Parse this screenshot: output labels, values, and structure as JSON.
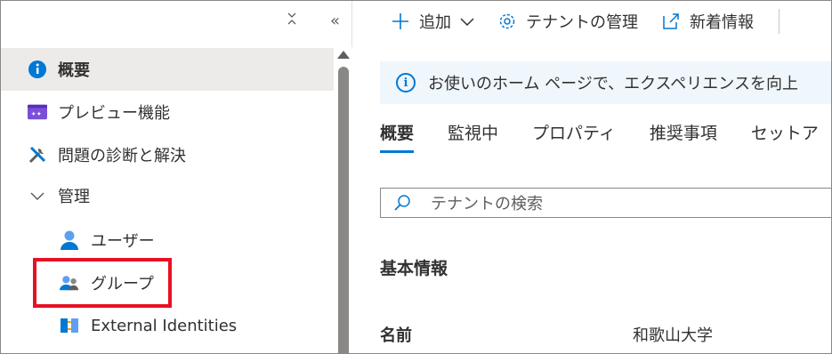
{
  "nav": {
    "controls": {
      "collapse": "⌅",
      "double_left": "«"
    },
    "items": [
      {
        "label": "概要",
        "icon": "info-icon",
        "selected": true
      },
      {
        "label": "プレビュー機能",
        "icon": "preview-features-icon"
      },
      {
        "label": "問題の診断と解決",
        "icon": "wrench-screwdriver-icon"
      },
      {
        "label": "管理",
        "icon": "chevron-down-icon"
      },
      {
        "label": "ユーザー",
        "icon": "user-icon"
      },
      {
        "label": "グループ",
        "icon": "group-icon"
      },
      {
        "label": "External Identities",
        "icon": "external-identities-icon"
      }
    ]
  },
  "toolbar": {
    "add": "追加",
    "manage_tenants": "テナントの管理",
    "whats_new": "新着情報"
  },
  "banner": {
    "text": "お使いのホーム ページで、エクスペリエンスを向上"
  },
  "tabs": [
    "概要",
    "監視中",
    "プロパティ",
    "推奨事項",
    "セットア"
  ],
  "search": {
    "placeholder": "テナントの検索"
  },
  "basic_info": {
    "title": "基本情報",
    "name_label": "名前",
    "name_value": "和歌山大学"
  },
  "colors": {
    "accent": "#0078d4",
    "highlight": "#e81123",
    "selected_bg": "#edebe9"
  }
}
